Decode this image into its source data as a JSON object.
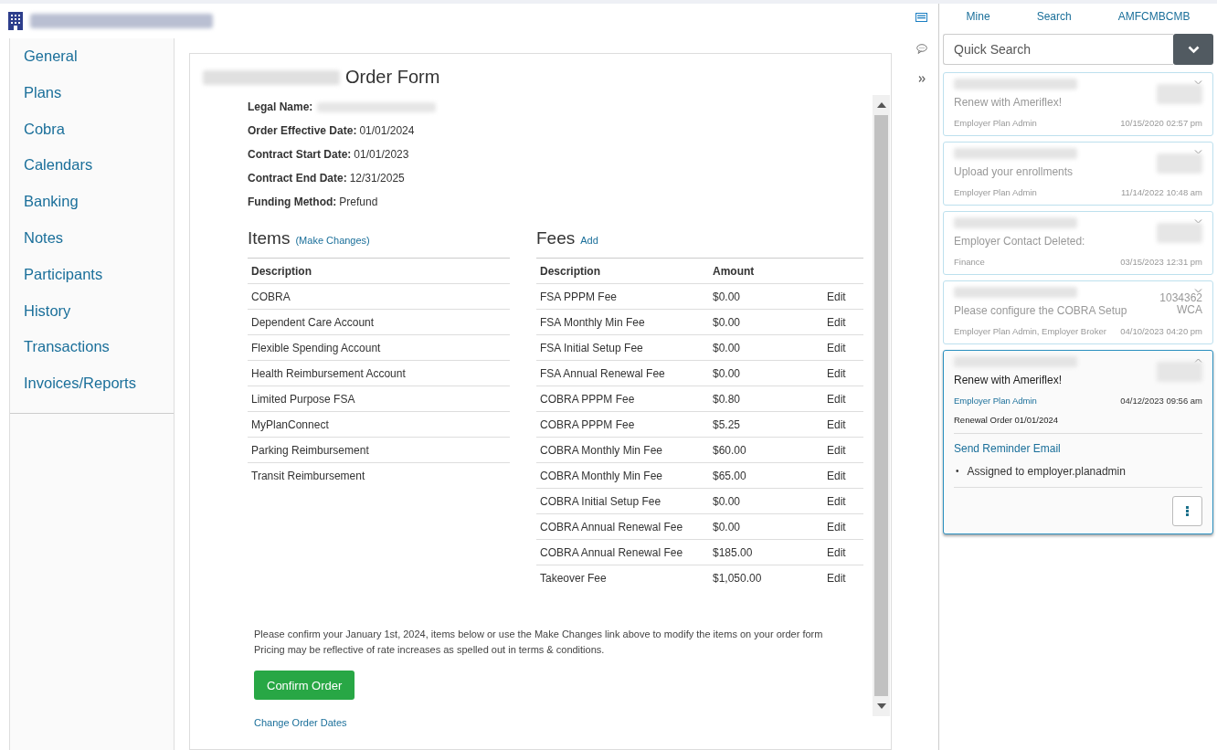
{
  "nav": {
    "items": [
      {
        "label": "General",
        "selected": false
      },
      {
        "label": "Plans",
        "selected": false
      },
      {
        "label": "Cobra",
        "selected": false
      },
      {
        "label": "Calendars",
        "selected": false
      },
      {
        "label": "Banking",
        "selected": false
      },
      {
        "label": "Notes",
        "selected": false
      },
      {
        "label": "Participants",
        "selected": false
      },
      {
        "label": "History",
        "selected": false
      },
      {
        "label": "Transactions",
        "selected": false
      },
      {
        "label": "Invoices/Reports",
        "selected": false
      }
    ]
  },
  "order_form": {
    "title": "Order Form",
    "fields": [
      {
        "label": "Legal Name:"
      },
      {
        "label": "Order Effective Date:",
        "value": "01/01/2024"
      },
      {
        "label": "Contract Start Date:",
        "value": "01/01/2023"
      },
      {
        "label": "Contract End Date:",
        "value": "12/31/2025"
      },
      {
        "label": "Funding Method:",
        "value": "Prefund"
      }
    ],
    "items": {
      "title": "Items",
      "link": "(Make Changes)",
      "columns": [
        "Description"
      ],
      "rows": [
        "COBRA",
        "Dependent Care Account",
        "Flexible Spending Account",
        "Health Reimbursement Account",
        "Limited Purpose FSA",
        "MyPlanConnect",
        "Parking Reimbursement",
        "Transit Reimbursement"
      ]
    },
    "fees": {
      "title": "Fees",
      "link": "Add",
      "columns": [
        "Description",
        "Amount"
      ],
      "rows": [
        {
          "description": "FSA PPPM Fee",
          "amount": "$0.00",
          "action": "Edit"
        },
        {
          "description": "FSA Monthly Min Fee",
          "amount": "$0.00",
          "action": "Edit"
        },
        {
          "description": "FSA Initial Setup Fee",
          "amount": "$0.00",
          "action": "Edit"
        },
        {
          "description": "FSA Annual Renewal Fee",
          "amount": "$0.00",
          "action": "Edit"
        },
        {
          "description": "COBRA PPPM Fee",
          "amount": "$0.80",
          "action": "Edit"
        },
        {
          "description": "COBRA PPPM Fee",
          "amount": "$5.25",
          "action": "Edit"
        },
        {
          "description": "COBRA Monthly Min Fee",
          "amount": "$60.00",
          "action": "Edit"
        },
        {
          "description": "COBRA Monthly Min Fee",
          "amount": "$65.00",
          "action": "Edit"
        },
        {
          "description": "COBRA Initial Setup Fee",
          "amount": "$0.00",
          "action": "Edit"
        },
        {
          "description": "COBRA Annual Renewal Fee",
          "amount": "$0.00",
          "action": "Edit"
        },
        {
          "description": "COBRA Annual Renewal Fee",
          "amount": "$185.00",
          "action": "Edit"
        },
        {
          "description": "Takeover Fee",
          "amount": "$1,050.00",
          "action": "Edit"
        }
      ]
    },
    "notice": [
      "Please confirm your January 1st, 2024, items below or use the Make Changes link above to modify the items on your order form",
      "Pricing may be reflective of rate increases as spelled out in terms & conditions."
    ],
    "confirm_button": "Confirm Order",
    "change_dates_link": "Change Order Dates"
  },
  "right_panel": {
    "tabs": [
      {
        "label": "Mine",
        "selected": false
      },
      {
        "label": "Search",
        "selected": false
      },
      {
        "label": "AMFCMBCMB",
        "selected": false
      }
    ],
    "search": {
      "placeholder": "Quick Search"
    },
    "cards": [
      {
        "message": "Renew with Ameriflex!",
        "roles": "Employer Plan Admin",
        "date": "10/15/2020 02:57 pm",
        "expanded": false
      },
      {
        "message": "Upload your enrollments",
        "roles": "Employer Plan Admin",
        "date": "11/14/2022 10:48 am",
        "expanded": false
      },
      {
        "message": "Employer Contact Deleted:",
        "roles": "Finance",
        "date": "03/15/2023 12:31 pm",
        "expanded": false
      },
      {
        "message": "Please configure the COBRA Setup",
        "reference": [
          "1034362",
          "WCA"
        ],
        "roles": "Employer Plan Admin, Employer Broker",
        "date": "04/10/2023 04:20 pm",
        "expanded": false
      },
      {
        "message": "Renew with Ameriflex!",
        "roles": "Employer Plan Admin",
        "date": "04/12/2023 09:56 am",
        "expanded": true,
        "detail": "Renewal Order 01/01/2024",
        "action": "Send Reminder Email",
        "bullets": [
          {
            "marker": "•",
            "text": "Assigned to employer.planadmin"
          }
        ]
      }
    ]
  }
}
